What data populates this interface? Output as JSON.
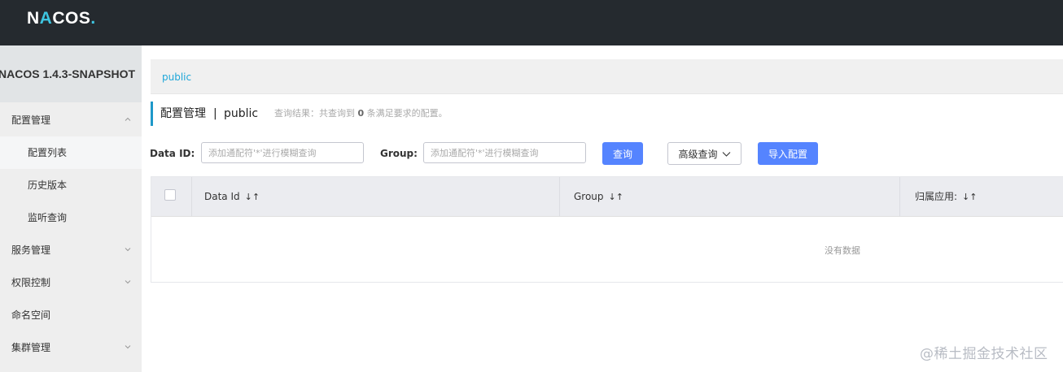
{
  "header": {
    "logo_prefix": "N",
    "logo_a": "A",
    "logo_cos": "COS",
    "logo_dot": "."
  },
  "sidebar": {
    "title": "NACOS 1.4.3-SNAPSHOT",
    "items": [
      {
        "label": "配置管理",
        "chevron": "chevron-up"
      },
      {
        "label": "配置列表"
      },
      {
        "label": "历史版本"
      },
      {
        "label": "监听查询"
      },
      {
        "label": "服务管理",
        "chevron": "chevron-down"
      },
      {
        "label": "权限控制",
        "chevron": "chevron-down"
      },
      {
        "label": "命名空间"
      },
      {
        "label": "集群管理",
        "chevron": "chevron-down"
      }
    ]
  },
  "breadcrumb": {
    "namespace": "public"
  },
  "page_header": {
    "title": "配置管理",
    "separator": "|",
    "namespace": "public",
    "result_prefix": "查询结果：共查询到",
    "result_count": "0",
    "result_suffix": "条满足要求的配置。"
  },
  "filters": {
    "data_id_label": "Data ID:",
    "data_id_placeholder": "添加通配符'*'进行模糊查询",
    "group_label": "Group:",
    "group_placeholder": "添加通配符'*'进行模糊查询",
    "search_button": "查询",
    "advanced_button": "高级查询",
    "import_button": "导入配置"
  },
  "table": {
    "columns": [
      "Data Id",
      "Group",
      "归属应用:"
    ],
    "empty_text": "没有数据"
  },
  "watermark": "@稀土掘金技术社区",
  "colors": {
    "topbar": "#252a2f",
    "accent": "#1ea7d9",
    "primary_button": "#5584ff"
  }
}
